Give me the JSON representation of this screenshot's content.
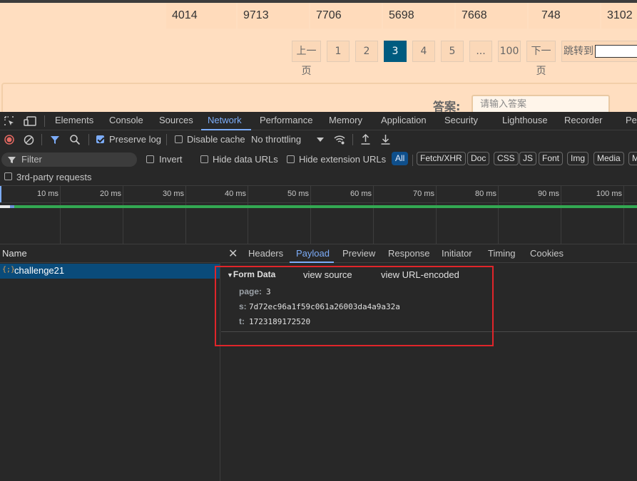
{
  "page": {
    "numbers": [
      "4014",
      "9713",
      "7706",
      "5698",
      "7668",
      "748",
      "3102"
    ],
    "pagination": {
      "prev": "上一页",
      "pages": [
        "1",
        "2",
        "3",
        "4",
        "5",
        "...",
        "100"
      ],
      "current": "3",
      "next": "下一页",
      "jump_label": "跳转到"
    },
    "answer": {
      "label": "答案:",
      "placeholder": "请输入答案"
    }
  },
  "devtools": {
    "main_tabs": [
      "Elements",
      "Console",
      "Sources",
      "Network",
      "Performance",
      "Memory",
      "Application",
      "Security",
      "Lighthouse",
      "Recorder",
      "Pe"
    ],
    "active_main_tab": "Network",
    "toolbar": {
      "preserve_log": "Preserve log",
      "disable_cache": "Disable cache",
      "throttling": "No throttling"
    },
    "filter": {
      "placeholder": "Filter",
      "invert": "Invert",
      "hide_data_urls": "Hide data URLs",
      "hide_extension_urls": "Hide extension URLs",
      "types": [
        "All",
        "Fetch/XHR",
        "Doc",
        "CSS",
        "JS",
        "Font",
        "Img",
        "Media",
        "M"
      ],
      "third_party": "3rd-party requests"
    },
    "timeline_ticks": [
      "10 ms",
      "20 ms",
      "30 ms",
      "40 ms",
      "50 ms",
      "60 ms",
      "70 ms",
      "80 ms",
      "90 ms",
      "100 ms"
    ],
    "requests": {
      "header": "Name",
      "items": [
        {
          "icon": "{;}",
          "name": "challenge21"
        }
      ]
    },
    "detail_tabs": [
      "Headers",
      "Payload",
      "Preview",
      "Response",
      "Initiator",
      "Timing",
      "Cookies"
    ],
    "active_detail_tab": "Payload",
    "payload": {
      "title": "Form Data",
      "view_source": "view source",
      "view_url_encoded": "view URL-encoded",
      "fields": [
        {
          "key": "page:",
          "value": "3"
        },
        {
          "key": "s:",
          "value": "7d72ec96a1f59c061a26003da4a9a32a"
        },
        {
          "key": "t:",
          "value": "1723189172520"
        }
      ]
    }
  }
}
